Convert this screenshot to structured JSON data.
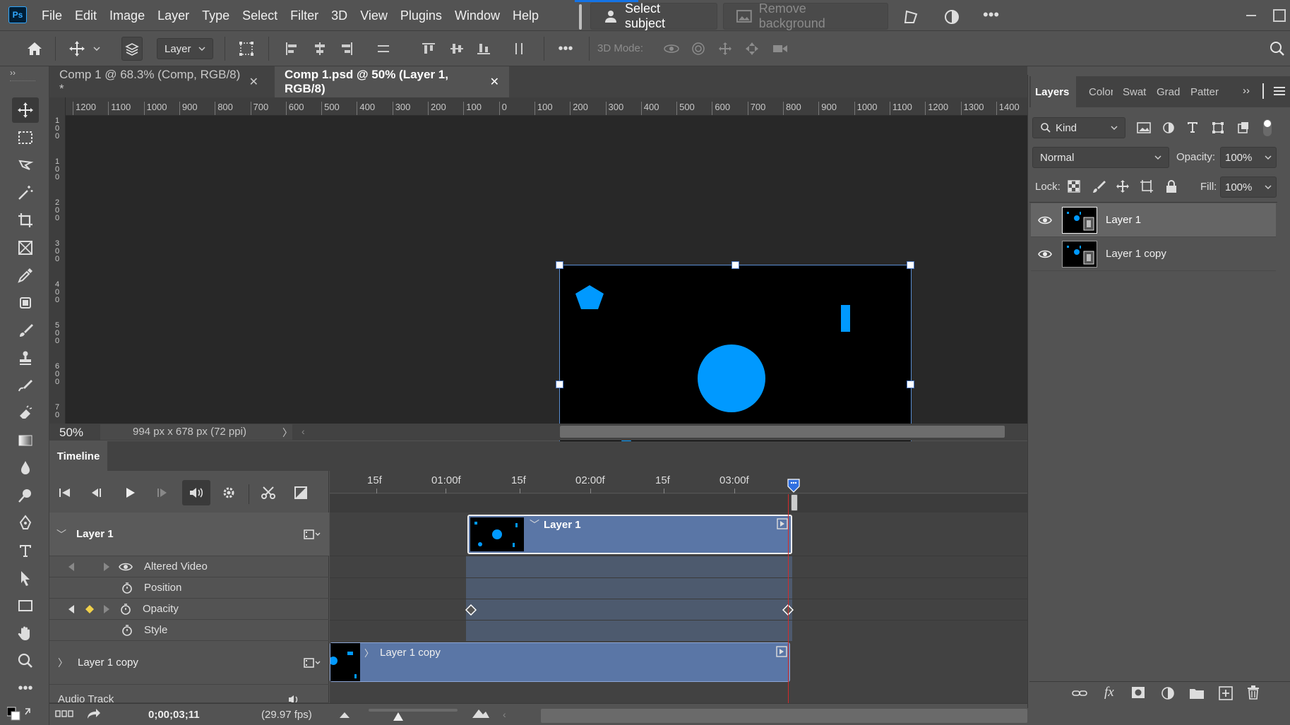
{
  "app": {
    "logo_text": "Ps",
    "menu": [
      "File",
      "Edit",
      "Image",
      "Layer",
      "Type",
      "Select",
      "Filter",
      "3D",
      "View",
      "Plugins",
      "Window",
      "Help"
    ],
    "select_subject": "Select subject",
    "remove_background": "Remove background"
  },
  "options": {
    "auto_select_target": "Layer",
    "mode_3d": "3D Mode:"
  },
  "tabs": [
    {
      "label": "Comp 1 @ 68.3% (Comp, RGB/8) *",
      "active": false
    },
    {
      "label": "Comp 1.psd @ 50% (Layer 1, RGB/8)",
      "active": true
    }
  ],
  "ruler": {
    "h_labels": [
      "1200",
      "1100",
      "1000",
      "900",
      "800",
      "700",
      "600",
      "500",
      "400",
      "300",
      "200",
      "100",
      "0",
      "100",
      "200",
      "300",
      "400",
      "500",
      "600",
      "700",
      "800",
      "900",
      "1000",
      "1100",
      "1200",
      "1300",
      "1400"
    ],
    "v_labels": [
      "1 0 0",
      "1 0 0",
      "2 0 0",
      "3 0 0",
      "4 0 0",
      "5 0 0",
      "6 0 0",
      "7 0"
    ]
  },
  "status": {
    "zoom": "50%",
    "doc_info": "994 px x 678 px (72 ppi)"
  },
  "timeline": {
    "title": "Timeline",
    "time_labels": [
      "15f",
      "01:00f",
      "15f",
      "02:00f",
      "15f",
      "03:00f"
    ],
    "layers": [
      {
        "name": "Layer 1",
        "expanded": true,
        "properties": [
          "Altered Video",
          "Position",
          "Opacity",
          "Style"
        ]
      },
      {
        "name": "Layer 1 copy",
        "expanded": false
      }
    ],
    "audio_track": "Audio Track",
    "timecode": "0;00;03;11",
    "fps": "(29.97 fps)"
  },
  "layers_panel": {
    "tabs": [
      "Layers",
      "Color",
      "Swat",
      "Grad",
      "Patter"
    ],
    "filter_kind": "Kind",
    "blend_mode": "Normal",
    "opacity_label": "Opacity:",
    "opacity_value": "100%",
    "lock_label": "Lock:",
    "fill_label": "Fill:",
    "fill_value": "100%",
    "layers": [
      {
        "name": "Layer 1",
        "selected": true,
        "visible": true
      },
      {
        "name": "Layer 1 copy",
        "selected": false,
        "visible": true
      }
    ]
  },
  "colors": {
    "accent_blue": "#0099ff",
    "playhead_red": "#d42a2a",
    "clip_blue": "#5a76a6"
  }
}
